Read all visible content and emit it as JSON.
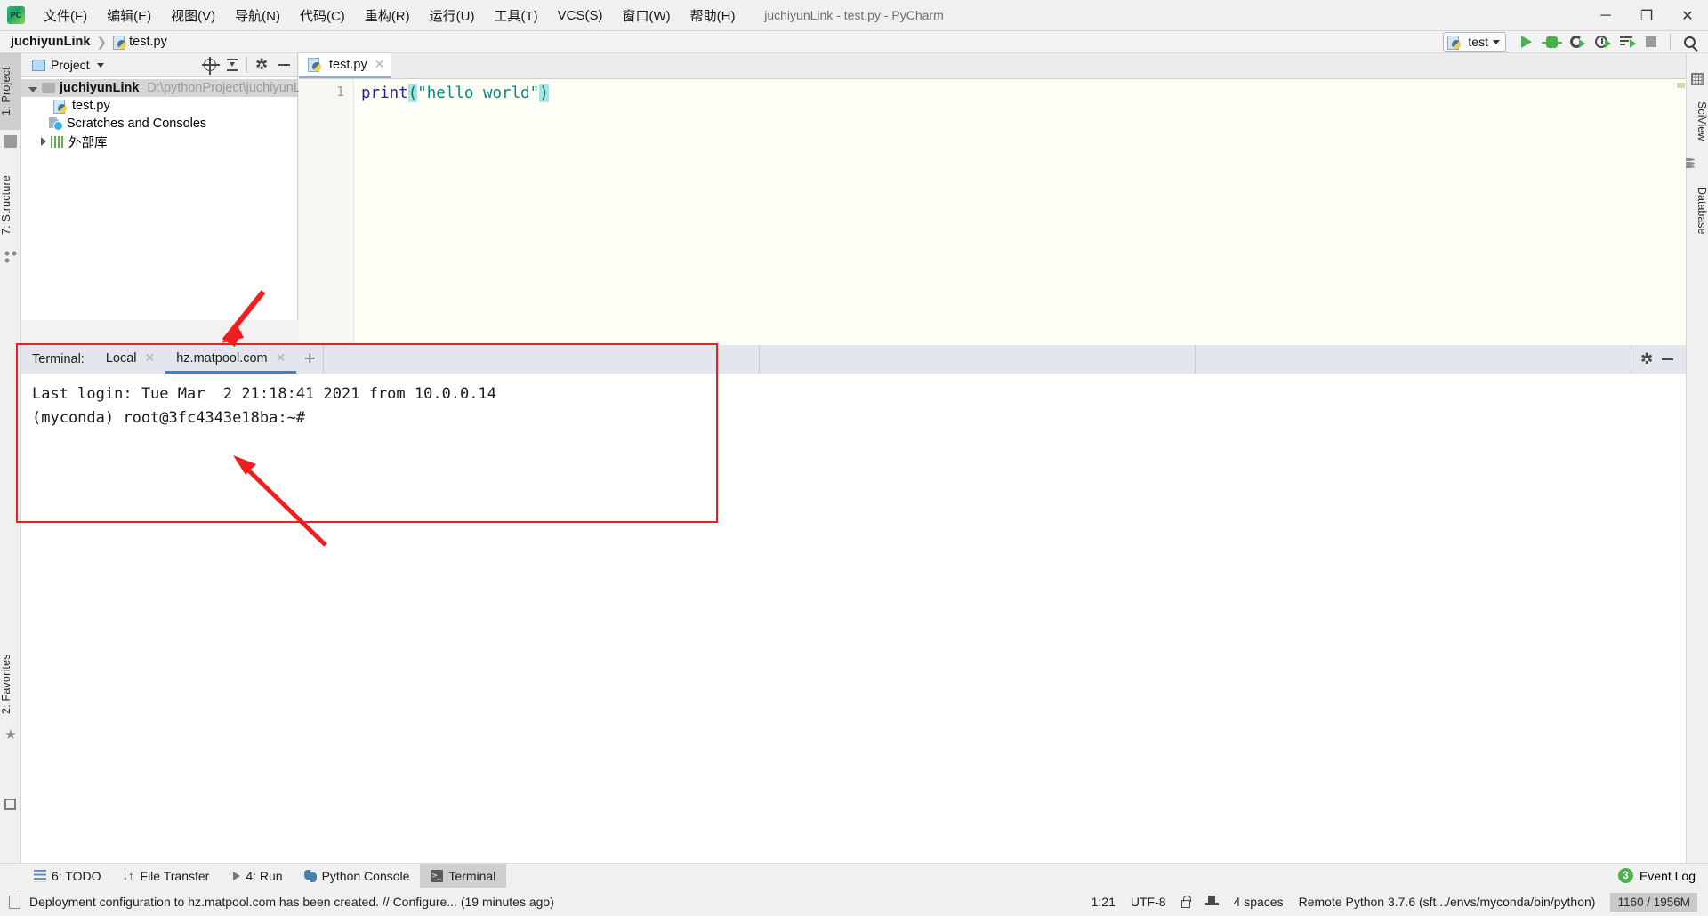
{
  "titlebar": {
    "logo_icon": "pycharm-logo-icon",
    "window_title": "juchiyunLink - test.py - PyCharm",
    "menus": [
      {
        "label": "文件(F)"
      },
      {
        "label": "编辑(E)"
      },
      {
        "label": "视图(V)"
      },
      {
        "label": "导航(N)"
      },
      {
        "label": "代码(C)"
      },
      {
        "label": "重构(R)"
      },
      {
        "label": "运行(U)"
      },
      {
        "label": "工具(T)"
      },
      {
        "label": "VCS(S)"
      },
      {
        "label": "窗口(W)"
      },
      {
        "label": "帮助(H)"
      }
    ],
    "minimize_label": "─",
    "maximize_label": "❐",
    "close_label": "✕"
  },
  "navbar": {
    "project_crumb": "juchiyunLink",
    "separator": "❯",
    "file_crumb": "test.py"
  },
  "runbar": {
    "config_name": "test",
    "config_icon": "python-file-icon",
    "run_icon": "run-icon",
    "debug_icon": "debug-icon",
    "coverage_icon": "run-with-coverage-icon",
    "profile_icon": "profile-icon",
    "concurrency_icon": "concurrency-diagram-icon",
    "stop_icon": "stop-icon",
    "search_icon": "search-everywhere-icon"
  },
  "left_strip": {
    "tabs": [
      {
        "label": "1: Project",
        "icon": "folder-icon",
        "selected": true
      },
      {
        "label": "7: Structure",
        "icon": "structure-icon",
        "selected": false
      },
      {
        "label": "2: Favorites",
        "icon": "star-icon",
        "selected": false
      }
    ],
    "bottom_icon": "window-icon"
  },
  "right_strip": {
    "tabs": [
      {
        "label": "SciView",
        "icon": "grid-icon"
      },
      {
        "label": "Database",
        "icon": "database-icon"
      }
    ]
  },
  "project_panel": {
    "header": {
      "icon": "project-view-icon",
      "title": "Project",
      "dropdown_icon": "chevron-down-icon",
      "locate_icon": "scroll-from-source-icon",
      "collapse_icon": "collapse-all-icon",
      "settings_icon": "gear-icon",
      "hide_icon": "hide-icon"
    },
    "tree": [
      {
        "label": "juchiyunLink",
        "path": "D:\\pythonProject\\juchiyunLink",
        "icon": "folder-icon",
        "twisty": "open",
        "selected": true,
        "indent": 0
      },
      {
        "label": "test.py",
        "icon": "python-file-icon",
        "twisty": "none",
        "selected": false,
        "indent": 1
      },
      {
        "label": "Scratches and Consoles",
        "icon": "scratches-icon",
        "twisty": "none",
        "selected": false,
        "indent": 0
      },
      {
        "label": "外部库",
        "icon": "libraries-icon",
        "twisty": "closed",
        "selected": false,
        "indent": 0
      }
    ]
  },
  "editor": {
    "tabs": [
      {
        "label": "test.py",
        "icon": "python-file-icon",
        "close_label": "✕",
        "active": true
      }
    ],
    "line_numbers": [
      "1"
    ],
    "code_line": {
      "fn": "print",
      "open_paren": "(",
      "string": "\"hello world\"",
      "close_paren": ")"
    }
  },
  "terminal": {
    "label": "Terminal:",
    "tabs": [
      {
        "label": "Local",
        "close_label": "✕",
        "active": false
      },
      {
        "label": "hz.matpool.com",
        "close_label": "✕",
        "active": true
      }
    ],
    "add_tab_label": "+",
    "settings_icon": "gear-icon",
    "hide_icon": "hide-icon",
    "lines": [
      "Last login: Tue Mar  2 21:18:41 2021 from 10.0.0.14",
      "(myconda) root@3fc4343e18ba:~#"
    ]
  },
  "bottom_bar": {
    "items": [
      {
        "label": "6: TODO",
        "icon": "todo-icon",
        "selected": false
      },
      {
        "label": "File Transfer",
        "icon": "file-transfer-icon",
        "selected": false
      },
      {
        "label": "4: Run",
        "icon": "run-icon",
        "selected": false
      },
      {
        "label": "Python Console",
        "icon": "python-console-icon",
        "selected": false
      },
      {
        "label": "Terminal",
        "icon": "terminal-icon",
        "selected": true
      }
    ],
    "event_log": {
      "label": "Event Log",
      "count": "3",
      "badge_color": "#4caf50"
    }
  },
  "status_bar": {
    "message": "Deployment configuration to hz.matpool.com has been created. // Configure... (19 minutes ago)",
    "doc_icon": "document-icon",
    "caret_position": "1:21",
    "encoding": "UTF-8",
    "lock_icon": "read-write-lock-icon",
    "hat_icon": "code-style-hat-icon",
    "indent": "4 spaces",
    "interpreter": "Remote Python 3.7.6 (sft.../envs/myconda/bin/python)",
    "memory": "1160 / 1956M"
  },
  "annotations": {
    "highlight_color": "#f01f1f",
    "arrow_1": "points-to-terminal-tab",
    "arrow_2": "points-to-prompt-line"
  }
}
